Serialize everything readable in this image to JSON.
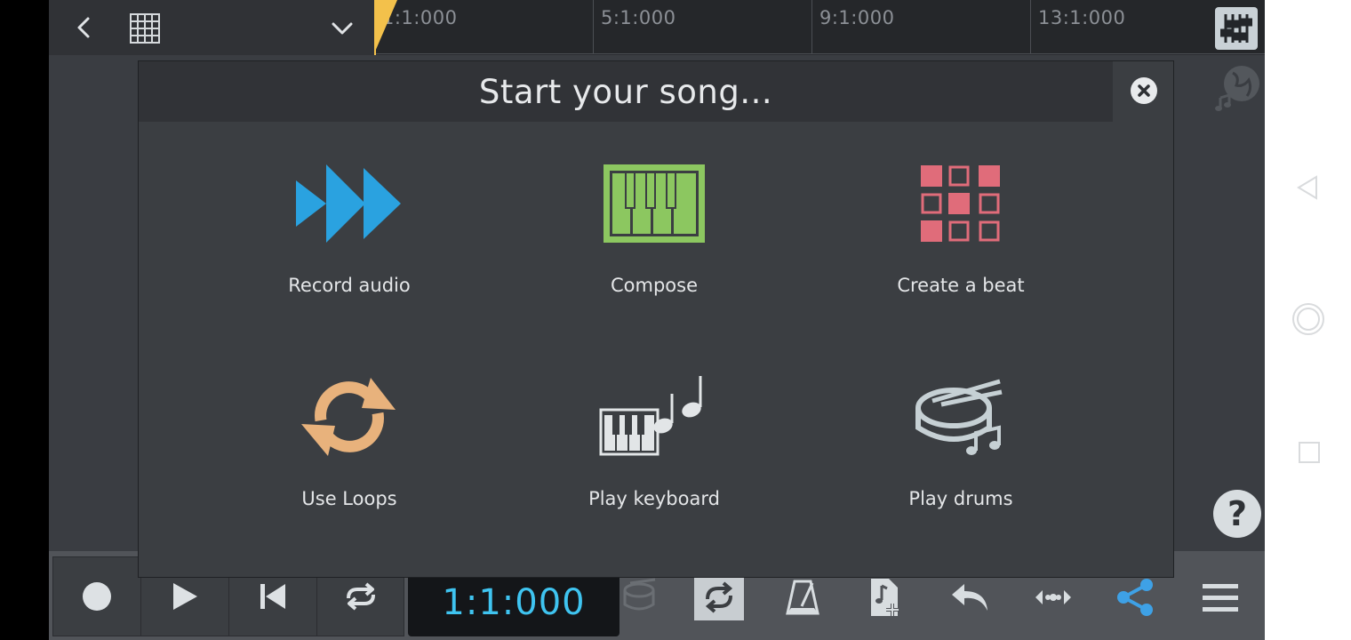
{
  "topbar": {
    "back_icon": "chevron-left-icon",
    "grid_icon": "grid-icon",
    "dropdown_icon": "chevron-down-icon",
    "timeline_marks": [
      "1:1:000",
      "5:1:000",
      "9:1:000",
      "13:1:000"
    ],
    "mixer_icon": "mixer-sliders-icon"
  },
  "side": {
    "globe_icon": "globe-music-icon",
    "help_label": "?"
  },
  "modal": {
    "title": "Start your song...",
    "close_icon": "close-icon",
    "options": [
      {
        "label": "Record audio",
        "icon": "fast-forward-arrows-icon",
        "color": "#2aa2e0"
      },
      {
        "label": "Compose",
        "icon": "piano-roll-icon",
        "color": "#8cc760"
      },
      {
        "label": "Create a beat",
        "icon": "drum-pads-icon",
        "color": "#e06c7a"
      },
      {
        "label": "Use Loops",
        "icon": "loop-arrows-icon",
        "color": "#e8b27c"
      },
      {
        "label": "Play keyboard",
        "icon": "keyboard-notes-icon",
        "color": "#d8dde0"
      },
      {
        "label": "Play drums",
        "icon": "drum-notes-icon",
        "color": "#c6d0d4"
      }
    ]
  },
  "transport": {
    "record_icon": "record-icon",
    "play_icon": "play-icon",
    "rewind_icon": "skip-back-icon",
    "loop_icon": "loop-icon",
    "time": "1:1:000"
  },
  "toolbar": {
    "icons": [
      "drum-loop-icon",
      "sync-icon",
      "metronome-icon",
      "add-file-icon",
      "undo-icon",
      "move-icon",
      "share-icon",
      "menu-icon"
    ],
    "share_color": "#3ea1e6"
  },
  "sysnav": {
    "back_icon": "triangle-back-icon",
    "home_icon": "circle-home-icon",
    "recent_icon": "square-recent-icon"
  }
}
